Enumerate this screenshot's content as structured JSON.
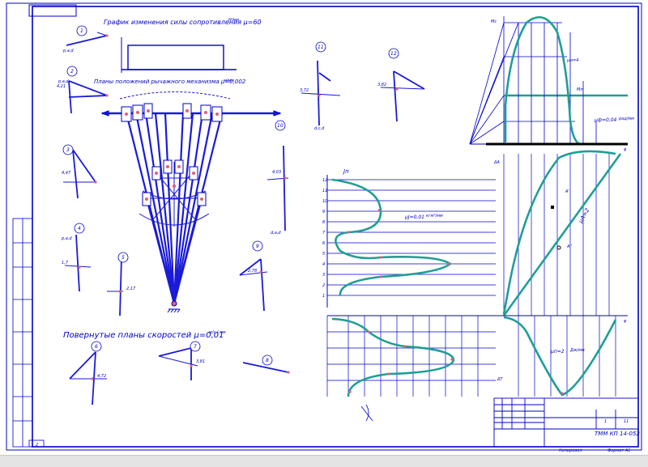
{
  "colors": {
    "ink": "#0000c8",
    "heavy": "#1a1ad8",
    "curve": "#1f9e96",
    "marker": "#e0607a",
    "paper": "#ffffff",
    "border": "#0000c8"
  },
  "titles": {
    "force_graph": "График изменения силы сопротивления μ=60",
    "force_graph_unit": "Н/мм",
    "positions_plan": "Планы положений рычажного механизма μ=0,002",
    "positions_plan_unit": "м/мм",
    "velocity_plans": "Повернутые планы скоростей μ=0,01",
    "velocity_plans_unit": "м/с / мм"
  },
  "plan_numbers": [
    "1",
    "2",
    "3",
    "4",
    "5",
    "6",
    "7",
    "8",
    "9",
    "10",
    "11",
    "12"
  ],
  "labels": {
    "pv_common": "р,а,d",
    "pv_dcd": "d,c,d",
    "pv_ddd": "d,a,d",
    "jn": "Jп",
    "mu_j": "μJ=0,01",
    "mu_j_unit": "кгм²/мм",
    "mu_mf": "μф=0,04",
    "mu_mf_unit": "рад/мм",
    "mu_n": "μп=2",
    "mu_n_unit": "Дж/мм",
    "mu_a": "μА=2",
    "mu_a_unit": "Дж/мм",
    "mc": "Мс",
    "mr": "Мп",
    "delta_t": "ΔT",
    "delta_a": "ΔA",
    "phi": "φ",
    "a_prime": "A'",
    "a_dprime": "A''",
    "mu_m": "μм=4",
    "mu_m_unit": "Нм/мм"
  },
  "values": {
    "v1": "4,21",
    "v2": "4,47",
    "v3": "1,7",
    "v4": "2,17",
    "v5": "2,78",
    "v6": "4,72",
    "v7": "3,81",
    "v8": "4,03",
    "v9": "3,72",
    "v10": "3,82"
  },
  "axis_ticks": [
    "0",
    "1",
    "2",
    "3",
    "4",
    "5",
    "6",
    "7",
    "8",
    "9",
    "10",
    "11",
    "12"
  ],
  "title_block": {
    "code": "ТММ КП 14-052",
    "sheet": "1",
    "sheets": "11",
    "footer_left": "Копировал",
    "footer_right": "Формат А1"
  },
  "page_corner": "2",
  "bottom_left_marks": "Ст"
}
